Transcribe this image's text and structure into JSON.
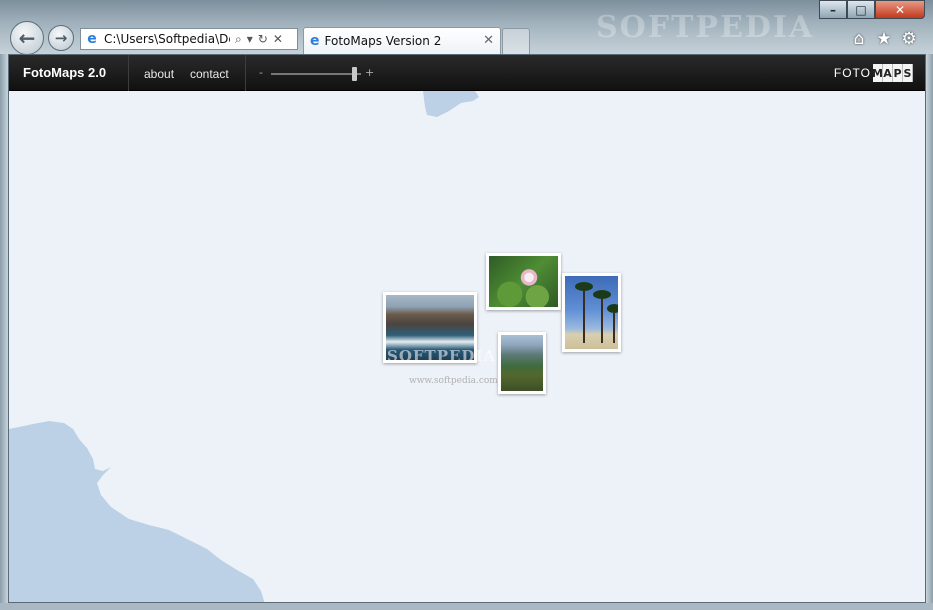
{
  "browser": {
    "address_url": "C:\\Users\\Softpedia\\Des",
    "tab_title": "FotoMaps Version 2",
    "watermark": "SOFTPEDIA",
    "window_controls": {
      "minimize": "–",
      "maximize": "□",
      "close": "✕"
    },
    "icons": [
      "back-arrow-icon",
      "forward-arrow-icon",
      "ie-logo-icon",
      "search-icon",
      "refresh-icon",
      "close-icon",
      "home-icon",
      "star-icon",
      "gear-icon"
    ]
  },
  "app": {
    "brand": "FotoMaps 2.0",
    "nav": [
      {
        "label": "about"
      },
      {
        "label": "contact"
      }
    ],
    "zoom": {
      "minus": "-",
      "plus": "+",
      "level": 0.92
    },
    "logo": {
      "foto": "FOTO",
      "maps_letters": [
        "M",
        "A",
        "P",
        "S"
      ]
    }
  },
  "map": {
    "water_color": "#bcd0e6",
    "land_color": "#edf2f8"
  },
  "photos": [
    {
      "name": "photo-wave"
    },
    {
      "name": "photo-lotus"
    },
    {
      "name": "photo-palm"
    },
    {
      "name": "photo-lake"
    }
  ],
  "overlay": {
    "watermark": "SOFTPEDIA",
    "watermark_url": "www.softpedia.com"
  }
}
